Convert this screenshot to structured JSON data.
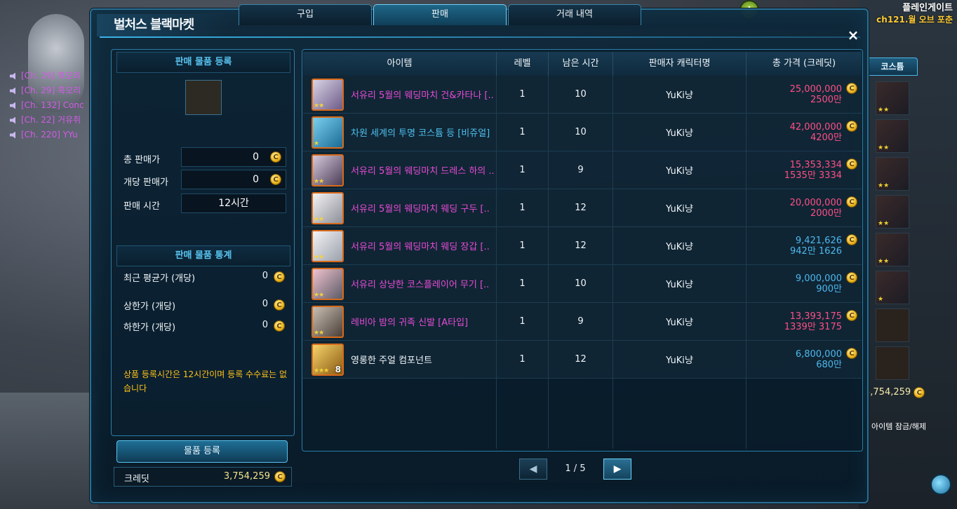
{
  "server": {
    "name": "플레인게이트",
    "channel": "ch121.월 오브 포춘"
  },
  "chat": [
    "[Ch. 29] 흑모리",
    "[Ch. 29] 흑모리",
    "[Ch. 132] Conc",
    "[Ch. 22] 거유취",
    "[Ch. 220] YYu"
  ],
  "window": {
    "title": "벌처스 블랙마켓",
    "close": "×"
  },
  "tabs": [
    {
      "label": "구입",
      "active": false
    },
    {
      "label": "판매",
      "active": true
    },
    {
      "label": "거래 내역",
      "active": false
    }
  ],
  "register": {
    "header": "판매 물품 등록",
    "total_price_label": "총 판매가",
    "total_price_value": "0",
    "unit_price_label": "개당 판매가",
    "unit_price_value": "0",
    "duration_label": "판매 시간",
    "duration_value": "12시간"
  },
  "stats": {
    "header": "판매 물품 통계",
    "avg_label": "최근 평균가 (개당)",
    "avg_value": "0",
    "max_label": "상한가 (개당)",
    "max_value": "0",
    "min_label": "하한가 (개당)",
    "min_value": "0"
  },
  "notice": "상품 등록시간은 12시간이며 등록 수수료는 없습니다",
  "register_button": "물품 등록",
  "credit": {
    "label": "크레딧",
    "value": "3,754,259"
  },
  "coin_glyph": "C",
  "table": {
    "headers": {
      "item": "아이템",
      "level": "레벨",
      "time": "남은 시간",
      "seller": "판매자 캐릭터명",
      "price": "총 가격 (크레딧)"
    },
    "rows": [
      {
        "name": "서유리 5월의 웨딩마치 건&카타나 [..",
        "name_color": "pink",
        "stars": "★★",
        "qty": "",
        "level": "1",
        "time": "10",
        "seller": "YuKi냥",
        "price": "25,000,000",
        "price_sub": "2500만",
        "price_color": "pink"
      },
      {
        "name": "차원 세계의 투명 코스튬 등 [비쥬얼]",
        "name_color": "cyan",
        "stars": "★",
        "qty": "",
        "level": "1",
        "time": "10",
        "seller": "YuKi냥",
        "price": "42,000,000",
        "price_sub": "4200만",
        "price_color": "pink"
      },
      {
        "name": "서유리 5월의 웨딩마치 드레스 하의 ..",
        "name_color": "pink",
        "stars": "★★",
        "qty": "",
        "level": "1",
        "time": "9",
        "seller": "YuKi냥",
        "price": "15,353,334",
        "price_sub": "1535만 3334",
        "price_color": "pink"
      },
      {
        "name": "서유리 5월의 웨딩마치 웨딩 구두 [..",
        "name_color": "pink",
        "stars": "★★",
        "qty": "",
        "level": "1",
        "time": "12",
        "seller": "YuKi냥",
        "price": "20,000,000",
        "price_sub": "2000만",
        "price_color": "pink"
      },
      {
        "name": "서유리 5월의 웨딩마치 웨딩 장갑 [..",
        "name_color": "pink",
        "stars": "★★",
        "qty": "",
        "level": "1",
        "time": "12",
        "seller": "YuKi냥",
        "price": "9,421,626",
        "price_sub": "942만 1626",
        "price_color": "blue"
      },
      {
        "name": "서유리 상냥한 코스플레이어 무기 [..",
        "name_color": "pink",
        "stars": "★★",
        "qty": "",
        "level": "1",
        "time": "10",
        "seller": "YuKi냥",
        "price": "9,000,000",
        "price_sub": "900만",
        "price_color": "blue"
      },
      {
        "name": "레비아 밤의 귀족 신발 [A타입]",
        "name_color": "pink",
        "stars": "★★",
        "qty": "",
        "level": "1",
        "time": "9",
        "seller": "YuKi냥",
        "price": "13,393,175",
        "price_sub": "1339만 3175",
        "price_color": "pink"
      },
      {
        "name": "영롱한 주얼 컴포넌트",
        "name_color": "white",
        "stars": "★★★",
        "qty": "8",
        "level": "1",
        "time": "12",
        "seller": "YuKi냥",
        "price": "6,800,000",
        "price_sub": "680만",
        "price_color": "blue"
      }
    ]
  },
  "pager": {
    "text": "1 / 5",
    "prev": "◀",
    "next": "▶"
  },
  "inventory": {
    "tab": "코스튬",
    "credit": "3,754,259",
    "lock_label": "아이템 잠금/해제"
  }
}
